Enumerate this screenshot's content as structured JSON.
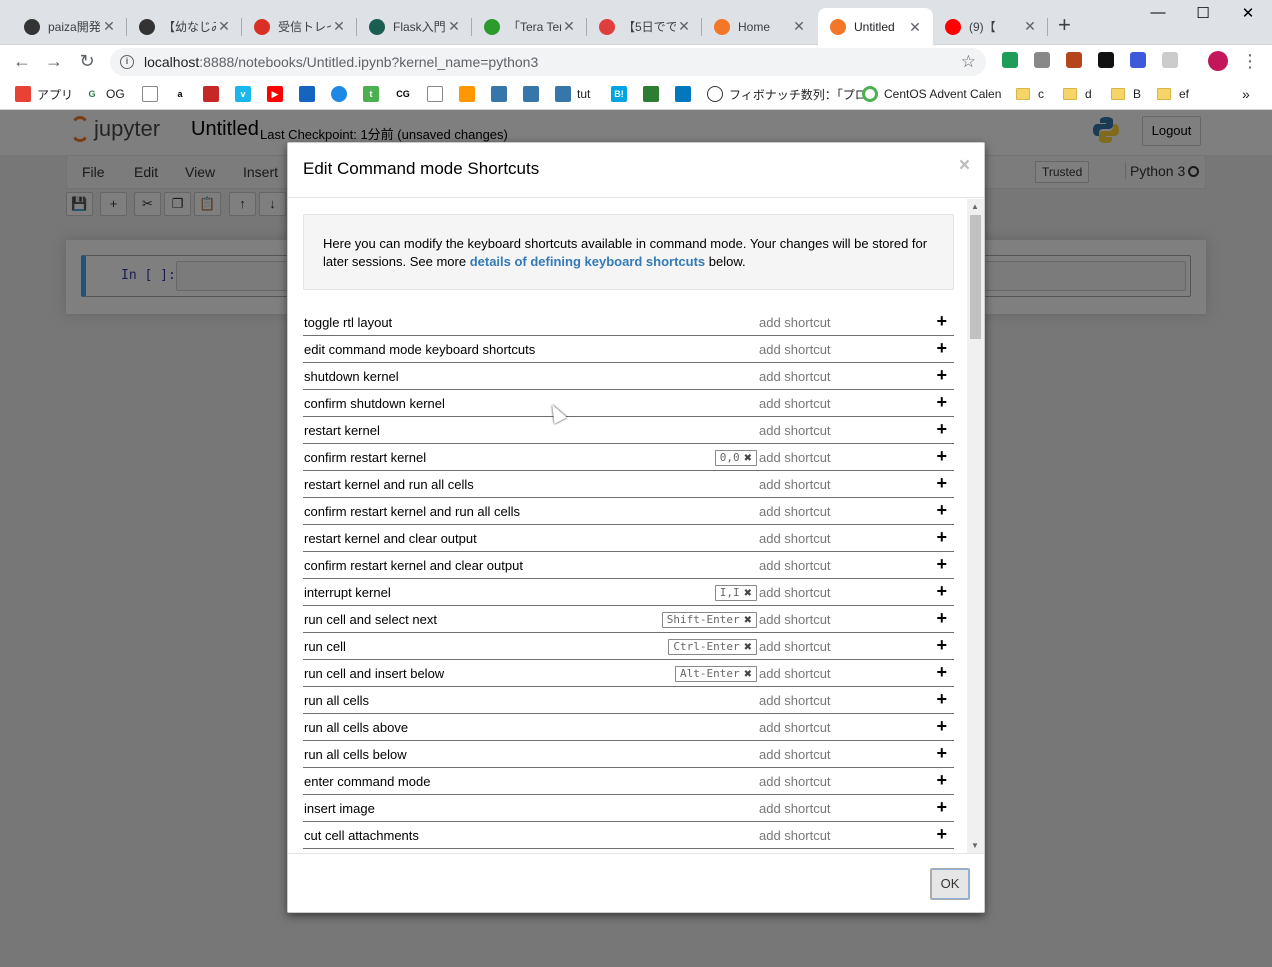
{
  "browser": {
    "tabs": [
      {
        "title": "paiza開発",
        "color": "#333"
      },
      {
        "title": "【幼なじみ",
        "color": "#333"
      },
      {
        "title": "受信トレイ",
        "color": "#d93025"
      },
      {
        "title": "Flask入門",
        "color": "#1a5e52"
      },
      {
        "title": "「Tera Ter",
        "color": "#2c9b2c"
      },
      {
        "title": "【5日でで",
        "color": "#e03e3e"
      },
      {
        "title": "Home",
        "color": "#f37726"
      },
      {
        "title": "Untitled",
        "color": "#f37726"
      },
      {
        "title": "(9)【",
        "color": "#ff0000"
      }
    ],
    "url_host": "localhost",
    "url_rest": ":8888/notebooks/Untitled.ipynb?kernel_name=python3",
    "bookmarks": [
      {
        "label": "アプリ"
      },
      {
        "label": "OG"
      },
      {
        "label": "tut"
      },
      {
        "label": "フィボナッチ数列：「プロ"
      },
      {
        "label": "CentOS Advent Calen"
      },
      {
        "label": "c"
      },
      {
        "label": "d"
      },
      {
        "label": "B"
      },
      {
        "label": "ef"
      }
    ]
  },
  "jupyter": {
    "logo_text": "jupyter",
    "notebook_name": "Untitled",
    "checkpoint": "Last Checkpoint: 1分前   (unsaved changes)",
    "logout": "Logout",
    "menu": [
      "File",
      "Edit",
      "View",
      "Insert"
    ],
    "trusted": "Trusted",
    "kernel": "Python 3",
    "prompt": "In [ ]:"
  },
  "modal": {
    "title": "Edit Command mode Shortcuts",
    "close": "×",
    "intro_before": "Here you can modify the keyboard shortcuts available in command mode. Your changes will be stored for later sessions. See more ",
    "intro_link": "details of defining keyboard shortcuts",
    "intro_after": " below.",
    "add_label": "add shortcut",
    "ok": "OK",
    "shortcuts": [
      {
        "name": "toggle rtl layout",
        "keys": ""
      },
      {
        "name": "edit command mode keyboard shortcuts",
        "keys": ""
      },
      {
        "name": "shutdown kernel",
        "keys": ""
      },
      {
        "name": "confirm shutdown kernel",
        "keys": ""
      },
      {
        "name": "restart kernel",
        "keys": ""
      },
      {
        "name": "confirm restart kernel",
        "keys": "0,0"
      },
      {
        "name": "restart kernel and run all cells",
        "keys": ""
      },
      {
        "name": "confirm restart kernel and run all cells",
        "keys": ""
      },
      {
        "name": "restart kernel and clear output",
        "keys": ""
      },
      {
        "name": "confirm restart kernel and clear output",
        "keys": ""
      },
      {
        "name": "interrupt kernel",
        "keys": "I,I"
      },
      {
        "name": "run cell and select next",
        "keys": "Shift-Enter"
      },
      {
        "name": "run cell",
        "keys": "Ctrl-Enter"
      },
      {
        "name": "run cell and insert below",
        "keys": "Alt-Enter"
      },
      {
        "name": "run all cells",
        "keys": ""
      },
      {
        "name": "run all cells above",
        "keys": ""
      },
      {
        "name": "run all cells below",
        "keys": ""
      },
      {
        "name": "enter command mode",
        "keys": ""
      },
      {
        "name": "insert image",
        "keys": ""
      },
      {
        "name": "cut cell attachments",
        "keys": ""
      }
    ]
  }
}
